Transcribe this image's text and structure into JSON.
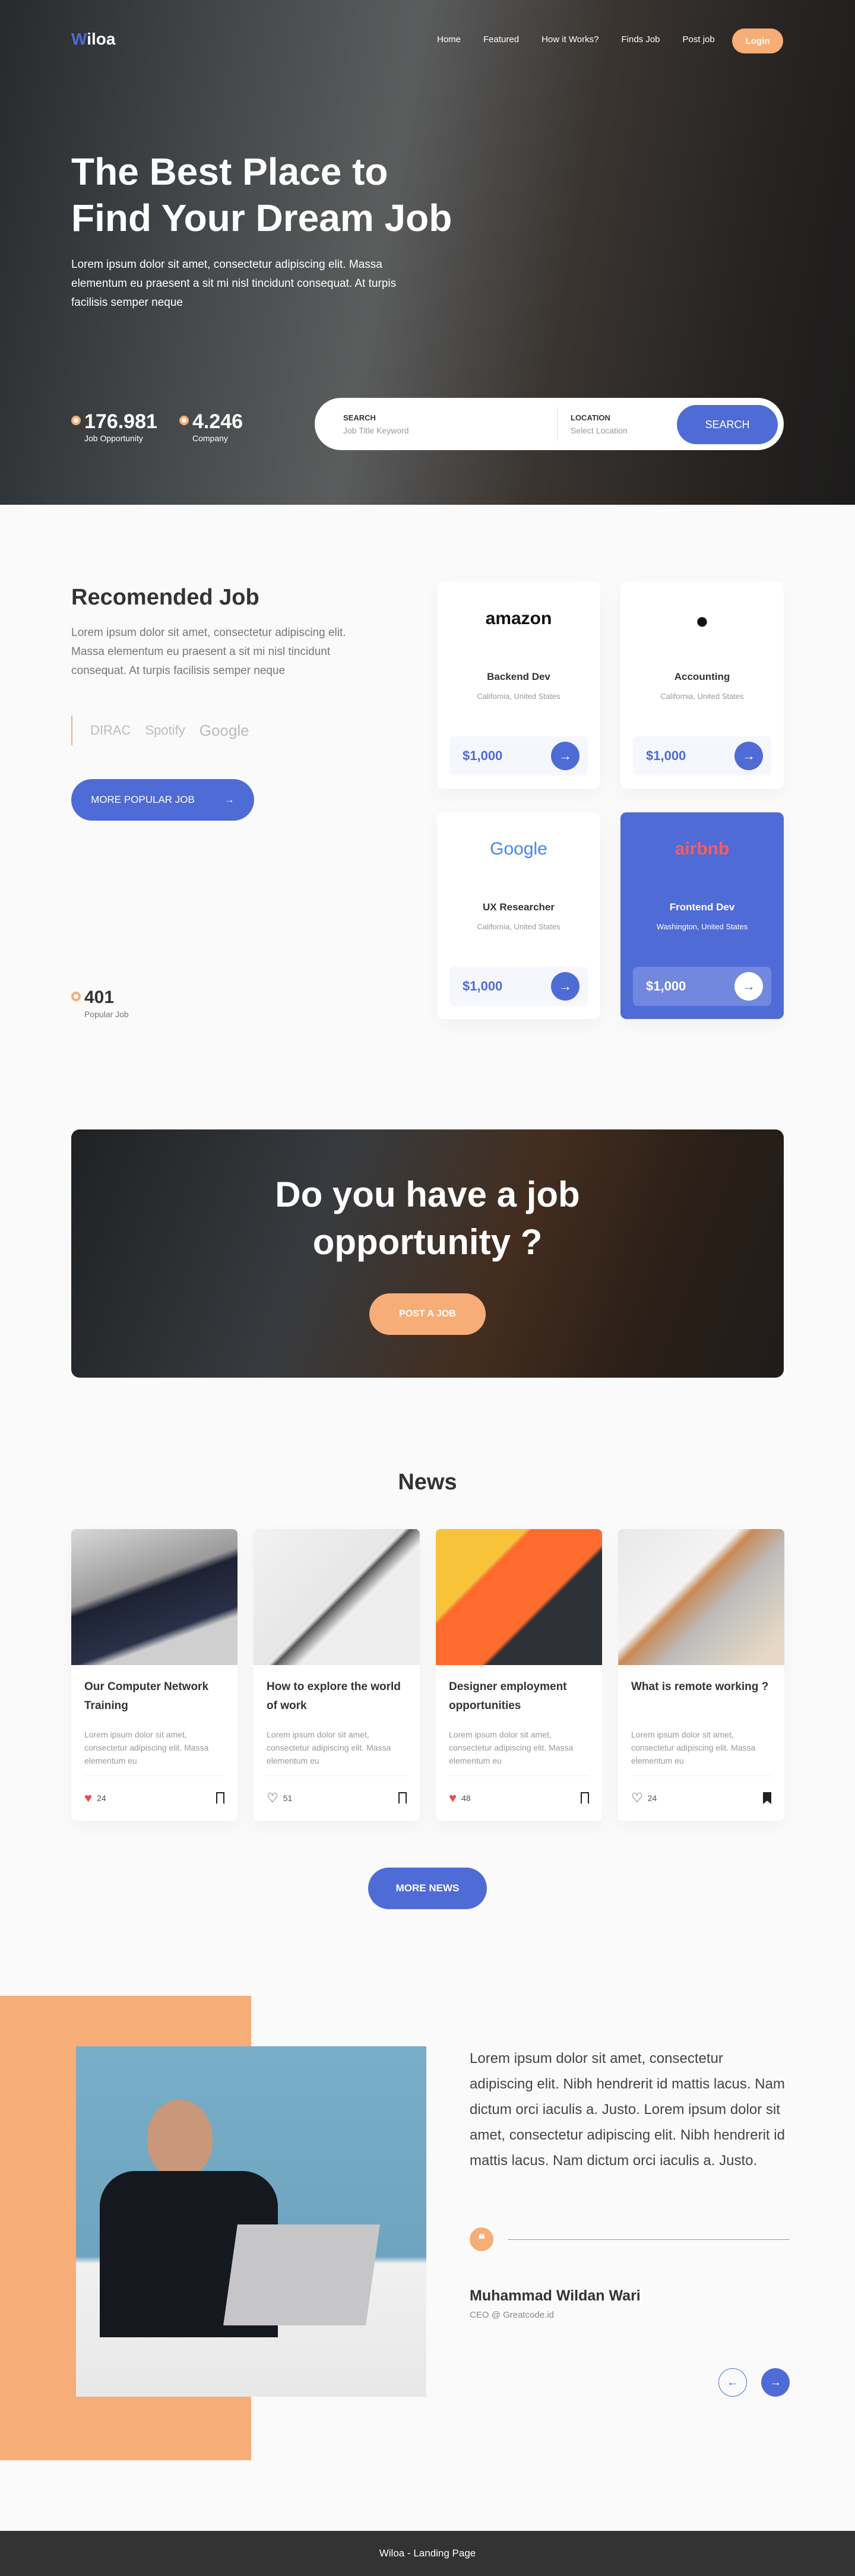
{
  "colors": {
    "accent": "#4f6bd6",
    "orange": "#f7ad77",
    "heart": "#e84c4f"
  },
  "nav": {
    "logo_first": "W",
    "logo_rest": "iloa",
    "links": [
      "Home",
      "Featured",
      "How it Works?",
      "Finds Job",
      "Post job"
    ],
    "login": "Login"
  },
  "hero": {
    "title_line1": "The Best Place to",
    "title_line2": "Find Your Dream Job",
    "paragraph": "Lorem ipsum dolor sit amet, consectetur adipiscing elit. Massa elementum eu praesent a sit mi nisl tincidunt consequat. At turpis facilisis semper neque",
    "stats": [
      {
        "value": "176.981",
        "label": "Job Opportunity"
      },
      {
        "value": "4.246",
        "label": "Company"
      }
    ],
    "search": {
      "label": "SEARCH",
      "placeholder": "Job Title Keyword",
      "location_label": "LOCATION",
      "location_placeholder": "Select Location",
      "button": "SEARCH"
    }
  },
  "recommended": {
    "title": "Recomended Job",
    "paragraph": "Lorem ipsum dolor sit amet, consectetur adipiscing elit. Massa elementum eu praesent a sit mi nisl tincidunt consequat. At turpis facilisis semper neque",
    "partners": [
      "DIRAC",
      "Spotify",
      "Google"
    ],
    "button": "MORE POPULAR JOB",
    "stat_value": "401",
    "stat_label": "Popular Job",
    "jobs": [
      {
        "company": "amazon",
        "title": "Backend Dev",
        "location": "California, United States",
        "price": "$1,000"
      },
      {
        "company": "Apple",
        "title": "Accounting",
        "location": "California, United States",
        "price": "$1,000"
      },
      {
        "company": "Google",
        "title": "UX Researcher",
        "location": "California, United States",
        "price": "$1,000"
      },
      {
        "company": "airbnb",
        "title": "Frontend Dev",
        "location": "Washington, United States",
        "price": "$1,000"
      }
    ]
  },
  "cta": {
    "title_line1": "Do you have a job",
    "title_line2": "opportunity ?",
    "button": "POST A JOB"
  },
  "news": {
    "title": "News",
    "button": "MORE NEWS",
    "items": [
      {
        "title": "Our Computer Network Training",
        "desc": "Lorem ipsum dolor sit amet, consectetur adipiscing elit. Massa elementum eu",
        "likes": "24",
        "liked": true,
        "saved": false
      },
      {
        "title": "How to explore the world of work",
        "desc": "Lorem ipsum dolor sit amet, consectetur adipiscing elit. Massa elementum eu",
        "likes": "51",
        "liked": false,
        "saved": false
      },
      {
        "title": "Designer employment opportunities",
        "desc": "Lorem ipsum dolor sit amet, consectetur adipiscing elit. Massa elementum eu",
        "likes": "48",
        "liked": true,
        "saved": false
      },
      {
        "title": "What is remote working ?",
        "desc": "Lorem ipsum dolor sit amet, consectetur adipiscing elit. Massa elementum eu",
        "likes": "24",
        "liked": false,
        "saved": true
      }
    ]
  },
  "testimonial": {
    "quote": "Lorem ipsum dolor sit amet, consectetur adipiscing elit. Nibh hendrerit id mattis lacus. Nam dictum orci iaculis a. Justo. Lorem ipsum dolor sit amet, consectetur adipiscing elit. Nibh hendrerit id mattis lacus. Nam dictum orci iaculis a. Justo.",
    "quote_mark": "❝",
    "name": "Muhammad Wildan Wari",
    "role": "CEO @ Greatcode.id"
  },
  "footer": {
    "text": "Wiloa - Landing Page"
  }
}
